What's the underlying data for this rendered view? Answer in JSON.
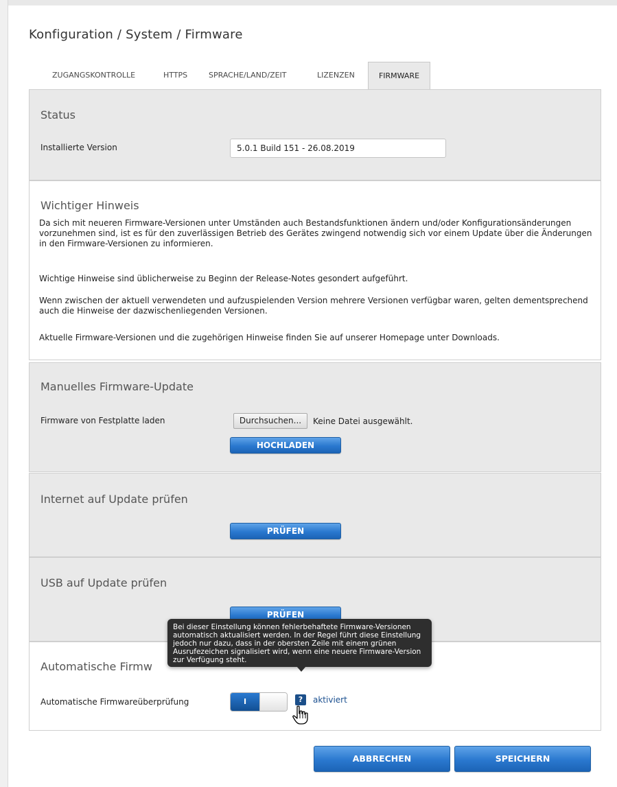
{
  "breadcrumb": "Konfiguration / System / Firmware",
  "tabs": [
    {
      "label": "ZUGANGSKONTROLLE",
      "active": false
    },
    {
      "label": "HTTPS",
      "active": false
    },
    {
      "label": "SPRACHE/LAND/ZEIT",
      "active": false
    },
    {
      "label": "LIZENZEN",
      "active": false
    },
    {
      "label": "FIRMWARE",
      "active": true
    }
  ],
  "status": {
    "title": "Status",
    "version_label": "Installierte Version",
    "version_value": "5.0.1 Build 151 - 26.08.2019"
  },
  "notice": {
    "title": "Wichtiger Hinweis",
    "paragraphs": [
      "Da sich mit neueren Firmware-Versionen unter Umständen auch Bestandsfunktionen ändern und/oder Konfigurationsänderungen vorzunehmen sind, ist es für den zuverlässigen Betrieb des Gerätes zwingend notwendig sich vor einem Update über die Änderungen in den Firmware-Versionen zu informieren.",
      "Wichtige Hinweise sind üblicherweise zu Beginn der Release-Notes gesondert aufgeführt.",
      "Wenn zwischen der aktuell verwendeten und aufzuspielenden Version mehrere Versionen verfügbar waren, gelten dementsprechend auch die Hinweise der dazwischenliegenden Versionen.",
      "Aktuelle Firmware-Versionen und die zugehörigen Hinweise finden Sie auf unserer Homepage unter Downloads."
    ]
  },
  "manual_update": {
    "title": "Manuelles Firmware-Update",
    "file_label": "Firmware von Festplatte laden",
    "browse_button": "Durchsuchen...",
    "file_status": "Keine Datei ausgewählt.",
    "upload_button": "HOCHLADEN"
  },
  "internet_check": {
    "title": "Internet auf Update prüfen",
    "button": "PRÜFEN"
  },
  "usb_check": {
    "title": "USB auf Update prüfen",
    "button": "PRÜFEN"
  },
  "auto_check": {
    "title": "Automatische Firmw",
    "label": "Automatische Firmwareüberprüfung",
    "toggle_on_text": "I",
    "toggle_state": "on",
    "help_icon": "?",
    "status_link": "aktiviert"
  },
  "tooltip": {
    "text": "Bei dieser Einstellung können fehlerbehaftete Firmware-Versionen automatisch aktualisiert werden. In der Regel führt diese Einstellung jedoch nur dazu, dass in der obersten Zeile mit einem grünen Ausrufezeichen signalisiert wird, wenn eine neuere Firmware-Version zur Verfügung steht."
  },
  "footer": {
    "cancel_button": "ABBRECHEN",
    "save_button": "SPEICHERN"
  },
  "colors": {
    "button_blue": "#2a78cf",
    "section_gray": "#e9e9e9",
    "tooltip_bg": "#2e2e2e",
    "link_blue": "#1a4f8f"
  }
}
